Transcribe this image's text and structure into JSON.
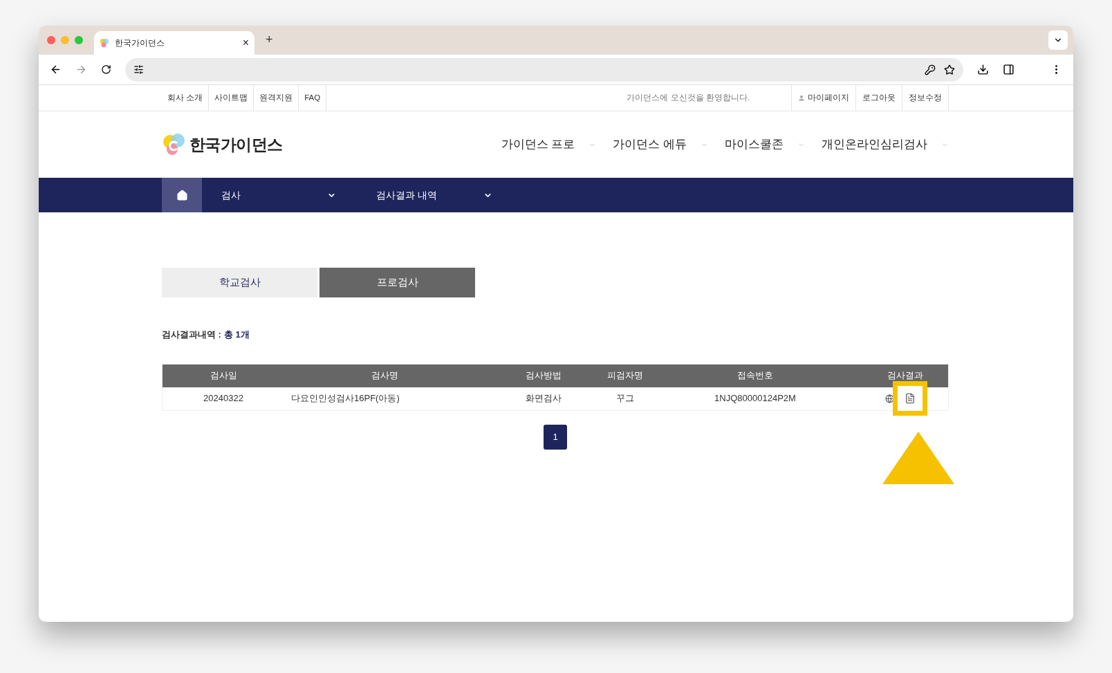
{
  "browser": {
    "tab_title": "한국가이던스",
    "close": "×",
    "new_tab": "+"
  },
  "utility_links": [
    "회사 소개",
    "사이트맵",
    "원격지원",
    "FAQ"
  ],
  "welcome": "가이던스에 오신것을 환영합니다.",
  "account_links": [
    {
      "label": "마이페이지",
      "kind": "user"
    },
    {
      "label": "로그아웃",
      "kind": "plain"
    },
    {
      "label": "정보수정",
      "kind": "plain"
    }
  ],
  "logo": "한국가이던스",
  "main_menu": [
    "가이던스 프로",
    "가이던스 에듀",
    "마이스쿨존",
    "개인온라인심리검사"
  ],
  "nav": [
    "검사",
    "검사결과 내역"
  ],
  "tabs": [
    {
      "label": "학교검사",
      "selected": false
    },
    {
      "label": "프로검사",
      "selected": true
    }
  ],
  "summary": {
    "label": "검사결과내역 :",
    "count": "총 1개"
  },
  "table": {
    "columns": [
      "검사일",
      "검사명",
      "검사방법",
      "피검자명",
      "접속번호",
      "검사결과"
    ],
    "rows": [
      {
        "date": "20240322",
        "name": "다요인인성검사16PF(아동)",
        "method": "화면검사",
        "person": "꾸그",
        "code": "1NJQ80000124P2M"
      }
    ]
  },
  "pagination": [
    {
      "label": "1",
      "selected": true
    }
  ]
}
